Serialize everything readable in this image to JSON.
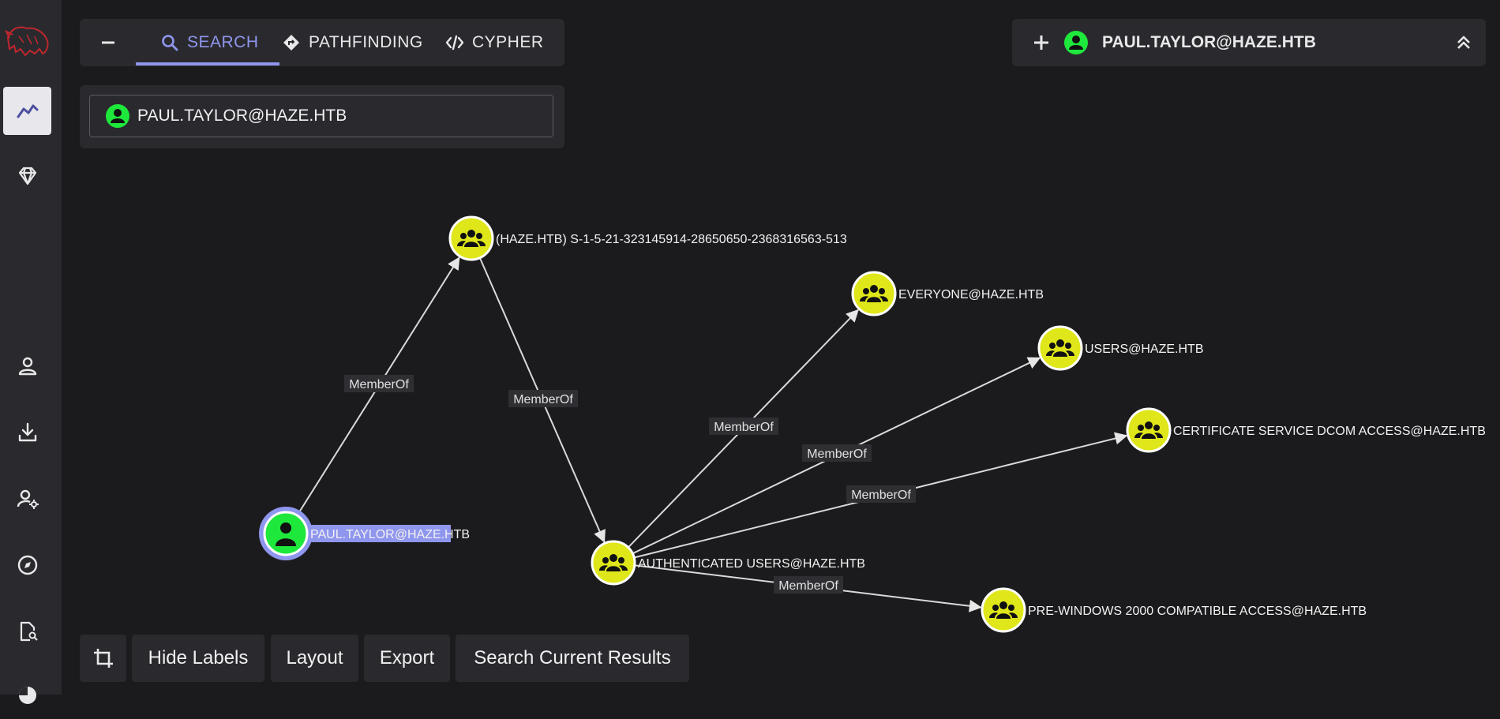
{
  "tabs": {
    "collapse_icon": "minus-icon",
    "items": [
      {
        "label": "SEARCH",
        "icon": "search-icon",
        "active": true
      },
      {
        "label": "PATHFINDING",
        "icon": "pathfinding-icon",
        "active": false
      },
      {
        "label": "CYPHER",
        "icon": "code-icon",
        "active": false
      }
    ]
  },
  "search": {
    "value": "PAUL.TAYLOR@HAZE.HTB"
  },
  "entity_panel": {
    "name": "PAUL.TAYLOR@HAZE.HTB"
  },
  "sidebar": {
    "items": [
      "explore-icon",
      "gem-icon",
      "user-icon",
      "download-icon",
      "user-settings-icon",
      "compass-icon",
      "file-search-icon",
      "pie-chart-icon"
    ]
  },
  "graph": {
    "nodes": [
      {
        "id": "paul",
        "type": "user",
        "label": "PAUL.TAYLOR@HAZE.HTB",
        "selected": true
      },
      {
        "id": "sid513",
        "type": "group",
        "label": "(HAZE.HTB) S-1-5-21-323145914-28650650-2368316563-513"
      },
      {
        "id": "authusers",
        "type": "group",
        "label": "AUTHENTICATED USERS@HAZE.HTB"
      },
      {
        "id": "everyone",
        "type": "group",
        "label": "EVERYONE@HAZE.HTB"
      },
      {
        "id": "users",
        "type": "group",
        "label": "USERS@HAZE.HTB"
      },
      {
        "id": "certdcom",
        "type": "group",
        "label": "CERTIFICATE SERVICE DCOM ACCESS@HAZE.HTB"
      },
      {
        "id": "prewin",
        "type": "group",
        "label": "PRE-WINDOWS 2000 COMPATIBLE ACCESS@HAZE.HTB"
      }
    ],
    "edges": [
      {
        "from": "paul",
        "to": "sid513",
        "label": "MemberOf"
      },
      {
        "from": "sid513",
        "to": "authusers",
        "label": "MemberOf"
      },
      {
        "from": "authusers",
        "to": "everyone",
        "label": "MemberOf"
      },
      {
        "from": "authusers",
        "to": "users",
        "label": "MemberOf"
      },
      {
        "from": "authusers",
        "to": "certdcom",
        "label": "MemberOf"
      },
      {
        "from": "authusers",
        "to": "prewin",
        "label": "MemberOf"
      }
    ]
  },
  "toolbar": {
    "crop_icon": "crop-icon",
    "hide_labels": "Hide Labels",
    "layout": "Layout",
    "export": "Export",
    "search_results": "Search Current Results"
  },
  "colors": {
    "accent": "#8f96ee",
    "user_node": "#1ee83b",
    "group_node": "#dfe619",
    "background": "#1b1b1d",
    "panel": "#2a2a2e"
  }
}
